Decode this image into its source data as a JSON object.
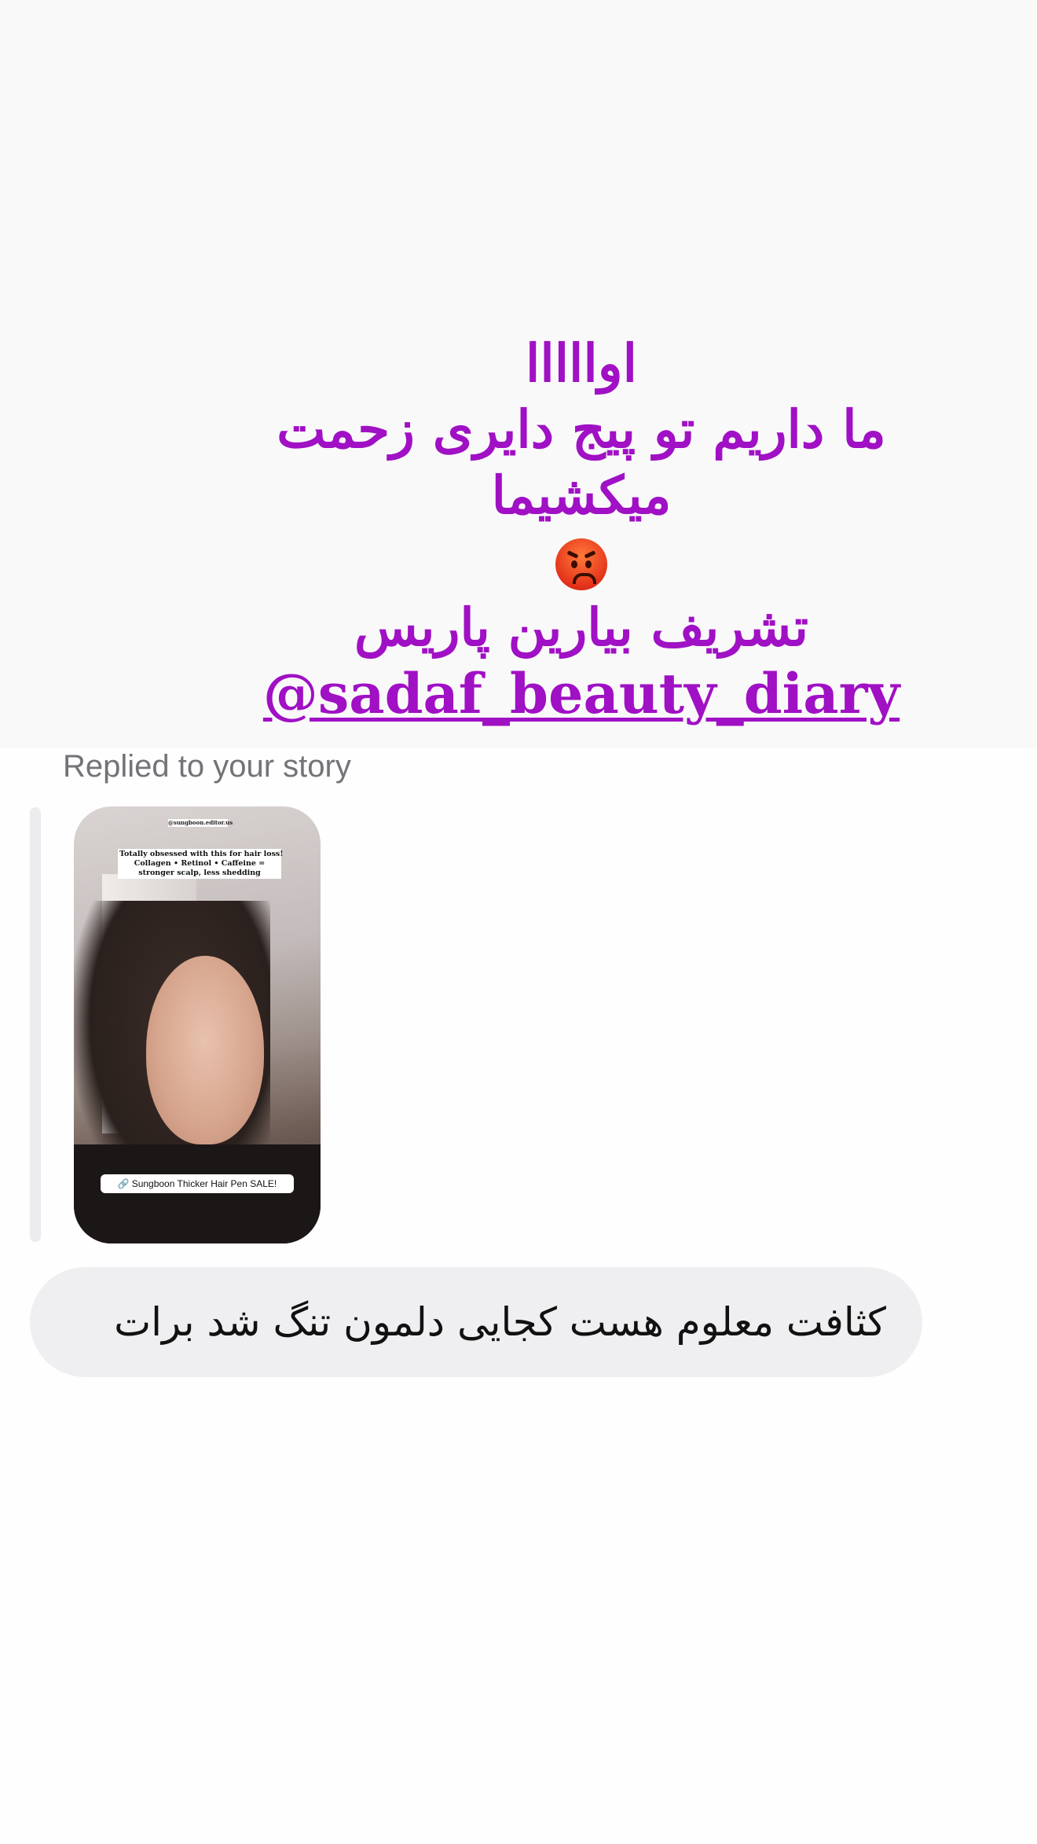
{
  "story": {
    "lines": [
      "اوااااا",
      "ما داریم تو پیج دایری زحمت",
      "میکشیما",
      "تشریف بیارین پاریس"
    ],
    "emoji": "angry-face-icon",
    "mention": "@sadaf_beauty_diary",
    "text_color": "#a010c4"
  },
  "reply": {
    "label": "Replied to your story"
  },
  "thumbnail": {
    "handle": "@sungboon.editor.us",
    "caption_lines": [
      "Totally obsessed with this for hair loss!",
      "Collagen • Retinol • Caffeine =",
      "stronger scalp, less shedding"
    ],
    "link_label": "Sungboon Thicker Hair Pen SALE!"
  },
  "message": {
    "text": "کثافت معلوم هست کجایی دلمون تنگ شد برات"
  }
}
